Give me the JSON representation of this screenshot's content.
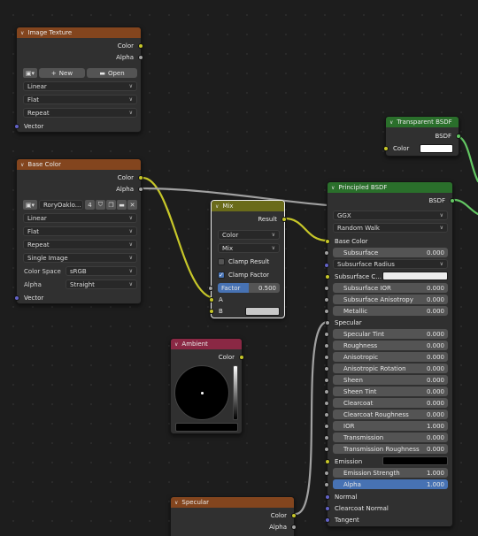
{
  "image_texture": {
    "title": "Image Texture",
    "outputs": [
      "Color",
      "Alpha"
    ],
    "new_label": "New",
    "open_label": "Open",
    "interpolation": "Linear",
    "projection": "Flat",
    "extension": "Repeat",
    "input_vector": "Vector"
  },
  "base_color": {
    "title": "Base Color",
    "outputs": [
      "Color",
      "Alpha"
    ],
    "image_name": "RoryOaklo...",
    "user_count": "4",
    "interpolation": "Linear",
    "projection": "Flat",
    "extension": "Repeat",
    "source": "Single Image",
    "color_space_label": "Color Space",
    "color_space": "sRGB",
    "alpha_label": "Alpha",
    "alpha_mode": "Straight",
    "input_vector": "Vector"
  },
  "mix": {
    "title": "Mix",
    "output": "Result",
    "data_type": "Color",
    "blend_mode": "Mix",
    "clamp_result": "Clamp Result",
    "clamp_factor": "Clamp Factor",
    "factor_label": "Factor",
    "factor_value": "0.500",
    "input_a": "A",
    "input_b": "B"
  },
  "ambient": {
    "title": "Ambient",
    "output": "Color"
  },
  "specular": {
    "title": "Specular",
    "outputs": [
      "Color",
      "Alpha"
    ]
  },
  "transparent": {
    "title": "Transparent BSDF",
    "output": "BSDF",
    "input_color": "Color"
  },
  "principled": {
    "title": "Principled BSDF",
    "output": "BSDF",
    "distribution": "GGX",
    "subsurface_method": "Random Walk",
    "base_color": "Base Color",
    "subsurface": {
      "label": "Subsurface",
      "value": "0.000"
    },
    "subsurface_radius": "Subsurface Radius",
    "subsurface_color": "Subsurface C...",
    "subsurface_ior": {
      "label": "Subsurface IOR",
      "value": "0.000"
    },
    "subsurface_anisotropy": {
      "label": "Subsurface Anisotropy",
      "value": "0.000"
    },
    "metallic": {
      "label": "Metallic",
      "value": "0.000"
    },
    "specular": "Specular",
    "specular_tint": {
      "label": "Specular Tint",
      "value": "0.000"
    },
    "roughness": {
      "label": "Roughness",
      "value": "0.000"
    },
    "anisotropic": {
      "label": "Anisotropic",
      "value": "0.000"
    },
    "anisotropic_rotation": {
      "label": "Anisotropic Rotation",
      "value": "0.000"
    },
    "sheen": {
      "label": "Sheen",
      "value": "0.000"
    },
    "sheen_tint": {
      "label": "Sheen Tint",
      "value": "0.000"
    },
    "clearcoat": {
      "label": "Clearcoat",
      "value": "0.000"
    },
    "clearcoat_roughness": {
      "label": "Clearcoat Roughness",
      "value": "0.000"
    },
    "ior": {
      "label": "IOR",
      "value": "1.000"
    },
    "transmission": {
      "label": "Transmission",
      "value": "0.000"
    },
    "transmission_roughness": {
      "label": "Transmission Roughness",
      "value": "0.000"
    },
    "emission": "Emission",
    "emission_strength": {
      "label": "Emission Strength",
      "value": "1.000"
    },
    "alpha": {
      "label": "Alpha",
      "value": "1.000"
    },
    "normal": "Normal",
    "clearcoat_normal": "Clearcoat Normal",
    "tangent": "Tangent"
  },
  "colors": {
    "texture_header": "#83451e",
    "shader_header": "#2a6f2b",
    "mix_header": "#6a6b1a",
    "ambient_header": "#8a2844",
    "socket_color": "#c7c729",
    "socket_float": "#a1a1a1",
    "socket_vector": "#6363c7",
    "socket_shader": "#63c763",
    "slider_active": "#4772b3"
  }
}
